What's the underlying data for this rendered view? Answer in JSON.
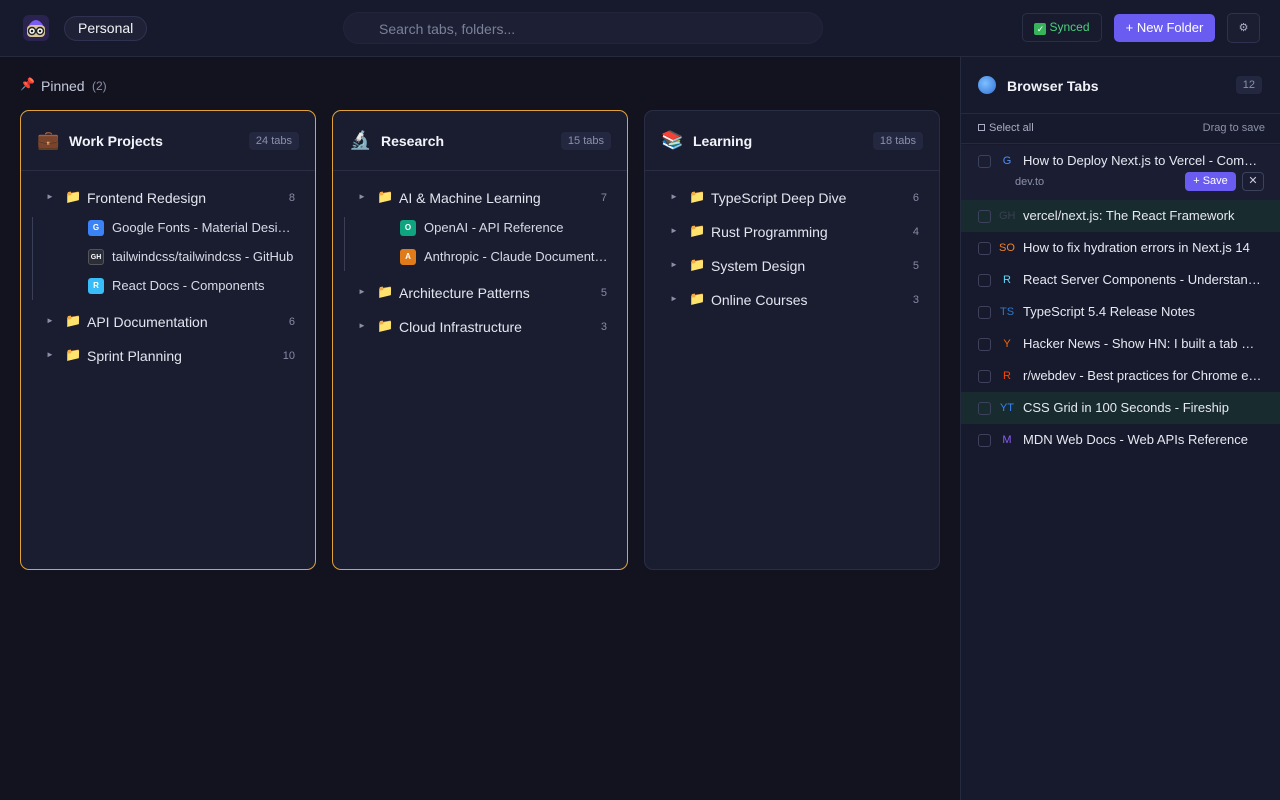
{
  "header": {
    "workspace": "Personal",
    "search_placeholder": "Search tabs, folders...",
    "sync_status": "Synced",
    "new_folder_label": "+ New Folder",
    "settings_icon": "gear-icon"
  },
  "pinned": {
    "label": "Pinned",
    "count": "(2)"
  },
  "cards": [
    {
      "title": "Work Projects",
      "icon": "💼",
      "count": "24 tabs",
      "pinned": true,
      "folders": [
        {
          "name": "Frontend Redesign",
          "count": "8",
          "expanded": true,
          "tabs": [
            {
              "title": "Google Fonts - Material Design Icons",
              "fav": "G",
              "color": "#3b82f6"
            },
            {
              "title": "tailwindcss/tailwindcss - GitHub",
              "fav": "GH",
              "color": "#2a2d3a"
            },
            {
              "title": "React Docs - Components",
              "fav": "R",
              "color": "#38bdf8"
            }
          ]
        },
        {
          "name": "API Documentation",
          "count": "6"
        },
        {
          "name": "Sprint Planning",
          "count": "10"
        }
      ]
    },
    {
      "title": "Research",
      "icon": "🔬",
      "count": "15 tabs",
      "pinned": true,
      "folders": [
        {
          "name": "AI & Machine Learning",
          "count": "7",
          "expanded": true,
          "tabs": [
            {
              "title": "OpenAI - API Reference",
              "fav": "O",
              "color": "#10a37f"
            },
            {
              "title": "Anthropic - Claude Documentation",
              "fav": "A",
              "color": "#e07b1a"
            }
          ]
        },
        {
          "name": "Architecture Patterns",
          "count": "5"
        },
        {
          "name": "Cloud Infrastructure",
          "count": "3"
        }
      ]
    },
    {
      "title": "Learning",
      "icon": "📚",
      "count": "18 tabs",
      "pinned": false,
      "folders": [
        {
          "name": "TypeScript Deep Dive",
          "count": "6"
        },
        {
          "name": "Rust Programming",
          "count": "4"
        },
        {
          "name": "System Design",
          "count": "5"
        },
        {
          "name": "Online Courses",
          "count": "3"
        }
      ]
    }
  ],
  "sidebar": {
    "title": "Browser Tabs",
    "count": "12",
    "select_all": "Select all",
    "drag_hint": "Drag to save",
    "expanded_tab": {
      "title": "How to Deploy Next.js to Vercel - Complete Guide",
      "fav": "G",
      "fav_color": "#4f8ef7",
      "domain": "dev.to",
      "save_label": "+ Save",
      "close_label": "✕"
    },
    "tabs": [
      {
        "title": "vercel/next.js: The React Framework",
        "fav": "GH",
        "color": "#3b3f52",
        "highlight": true
      },
      {
        "title": "How to fix hydration errors in Next.js 14",
        "fav": "SO",
        "color": "#f48024"
      },
      {
        "title": "React Server Components - Understanding the new paradigm",
        "fav": "R",
        "color": "#61dafb"
      },
      {
        "title": "TypeScript 5.4 Release Notes",
        "fav": "TS",
        "color": "#3178c6"
      },
      {
        "title": "Hacker News - Show HN: I built a tab manager",
        "fav": "Y",
        "color": "#ff6600"
      },
      {
        "title": "r/webdev - Best practices for Chrome extensions",
        "fav": "R",
        "color": "#ff4500"
      },
      {
        "title": "CSS Grid in 100 Seconds - Fireship",
        "fav": "YT",
        "color": "#3b82f6",
        "highlight": true
      },
      {
        "title": "MDN Web Docs - Web APIs Reference",
        "fav": "M",
        "color": "#8b5cf6"
      }
    ]
  }
}
